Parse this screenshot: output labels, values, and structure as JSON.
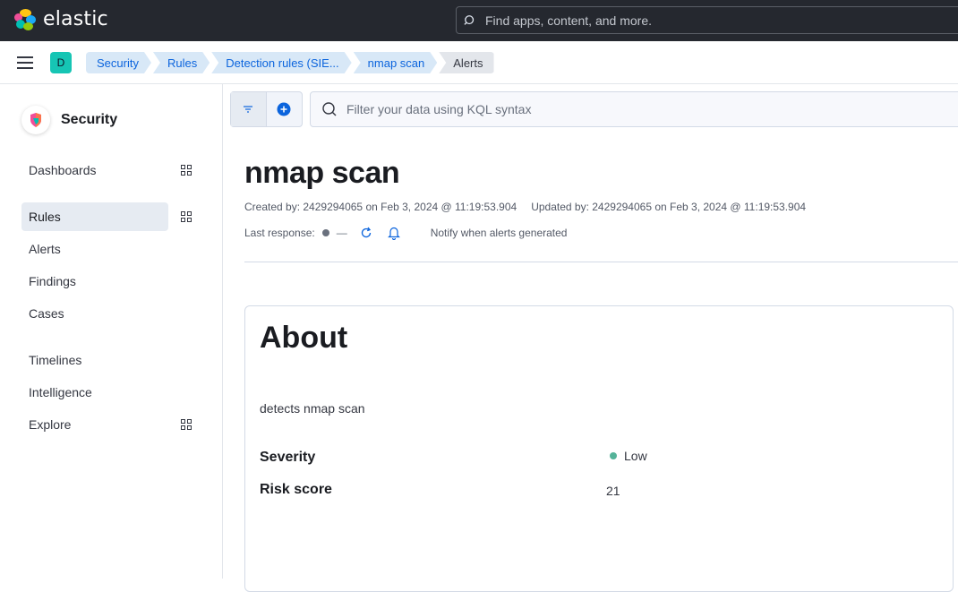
{
  "header": {
    "brand": "elastic",
    "search_placeholder": "Find apps, content, and more."
  },
  "breadcrumbs": {
    "space_initial": "D",
    "items": [
      "Security",
      "Rules",
      "Detection rules (SIE...",
      "nmap scan",
      "Alerts"
    ]
  },
  "sidebar": {
    "title": "Security",
    "items": [
      {
        "label": "Dashboards"
      },
      {
        "label": "Rules"
      },
      {
        "label": "Alerts"
      },
      {
        "label": "Findings"
      },
      {
        "label": "Cases"
      },
      {
        "label": "Timelines"
      },
      {
        "label": "Intelligence"
      },
      {
        "label": "Explore"
      }
    ],
    "active": "Rules"
  },
  "querybar": {
    "placeholder": "Filter your data using KQL syntax"
  },
  "rule": {
    "name": "nmap scan",
    "created": "Created by: 2429294065 on Feb 3, 2024 @ 11:19:53.904",
    "updated": "Updated by: 2429294065 on Feb 3, 2024 @ 11:19:53.904",
    "last_response_label": "Last response:",
    "last_response_value": "—",
    "notify_text": "Notify when alerts generated"
  },
  "about": {
    "title": "About",
    "description": "detects nmap scan",
    "severity_label": "Severity",
    "severity_value": "Low",
    "severity_color": "#54b399",
    "risk_label": "Risk score",
    "risk_value": "21"
  },
  "colors": {
    "header_bg": "#25282f",
    "accent": "#0b64dd",
    "space_avatar": "#16c5b4"
  }
}
